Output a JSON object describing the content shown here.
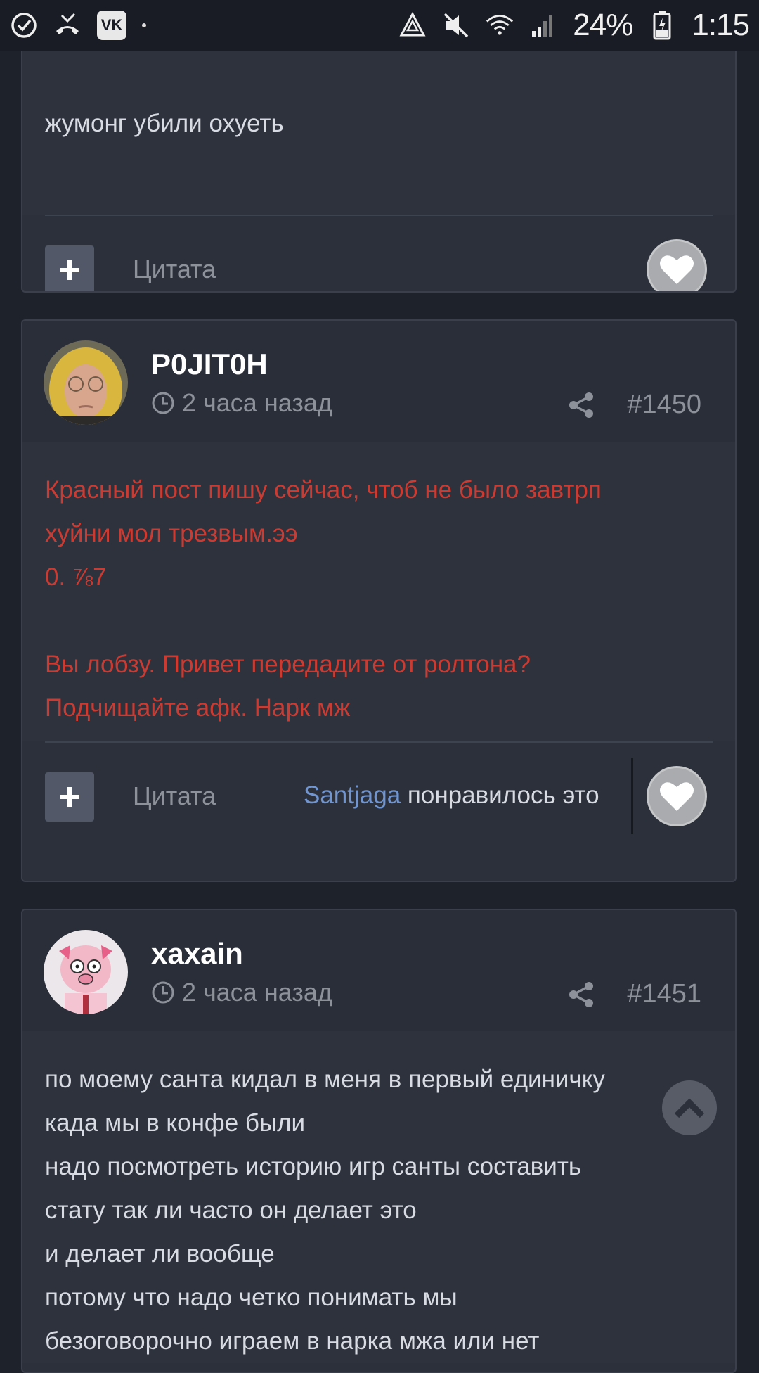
{
  "status_bar": {
    "left_icons": [
      "check-circle-icon",
      "missed-call-icon",
      "vk-icon",
      "dot-icon"
    ],
    "vk_label": "VK",
    "right_icons": [
      "recycle-icon",
      "mute-icon",
      "wifi-icon",
      "signal-icon"
    ],
    "battery": "24%",
    "time": "1:15"
  },
  "posts": [
    {
      "lines": [
        "жумонг убили охуеть"
      ],
      "quote_label": "Цитата"
    },
    {
      "username": "P0JIT0H",
      "time": "2 часа назад",
      "number": "#1450",
      "text_color": "#cc3b32",
      "lines": [
        "Красный пост пишу сейчас, чтоб не было завтрп",
        "хуйни мол трезвым.ээ",
        "0. ⅞7",
        "",
        "Вы лобзу. Привет передадите от ролтона?",
        "Подчищайте афк. Нарк мж"
      ],
      "quote_label": "Цитата",
      "liked_by": "Santjaga",
      "liked_text": " понравилось это"
    },
    {
      "username": "xaxain",
      "time": "2 часа назад",
      "number": "#1451",
      "lines": [
        "по моему санта кидал в меня в первый единичку",
        "када мы в конфе были",
        "надо посмотреть историю игр санты составить",
        "стату так ли часто он делает это",
        "и делает ли вообще",
        "потому что надо четко понимать мы",
        "безоговорочно играем в нарка мжа или нет"
      ]
    }
  ],
  "colors": {
    "background": "#1e222b",
    "card": "#2e323d",
    "red_text": "#cc3b32",
    "link_blue": "#7095d1",
    "muted": "#8d919a"
  }
}
